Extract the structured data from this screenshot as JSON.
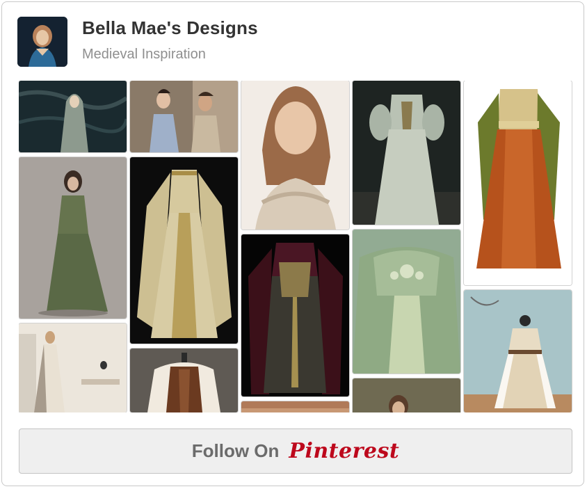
{
  "board": {
    "owner_name": "Bella Mae's Designs",
    "board_name": "Medieval Inspiration"
  },
  "pins": [
    {
      "name": "pin-hooded-cloak-forest",
      "description": "hooded woman in grey-green cloak in dark forest"
    },
    {
      "name": "pin-couple-renaissance",
      "description": "woman in blue gown beside man in tunic"
    },
    {
      "name": "pin-portrait-lace-gown",
      "description": "portrait of young woman in ivory lace gown"
    },
    {
      "name": "pin-silver-bodice-dress",
      "description": "silver-grey dress with puffed sleeves on mannequin"
    },
    {
      "name": "pin-orange-gold-gown",
      "description": "orange gown with gold bodice and green sleeves"
    },
    {
      "name": "pin-green-medieval-dress",
      "description": "woman standing in green medieval dress"
    },
    {
      "name": "pin-cream-embroidered-gown",
      "description": "cream gown with gold embroidery and long sleeves"
    },
    {
      "name": "pin-burgundy-velvet-gown",
      "description": "burgundy velvet gown with gold embroidery"
    },
    {
      "name": "pin-sage-beaded-dress",
      "description": "sage green beaded dress"
    },
    {
      "name": "pin-fur-trimmed-gown",
      "description": "ivory gown with white fur trim"
    },
    {
      "name": "pin-woman-white-gown-room",
      "description": "woman in white gown in a room"
    },
    {
      "name": "pin-peasant-bodice",
      "description": "white blouse with brown laced bodice"
    },
    {
      "name": "pin-partial-brown",
      "description": "partially visible warm-toned image"
    },
    {
      "name": "pin-partial-girl",
      "description": "partially visible girl portrait"
    }
  ],
  "follow_button": {
    "label": "Follow On",
    "brand": "Pinterest",
    "brand_color": "#bd081c"
  }
}
